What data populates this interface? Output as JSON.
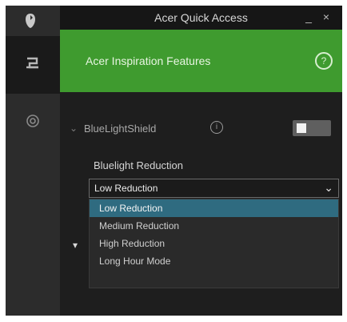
{
  "window": {
    "title": "Acer Quick Access",
    "minimize_glyph": "_",
    "close_glyph": "×"
  },
  "rail": {
    "logo_icon": "acer-logo-icon",
    "tabs": [
      {
        "icon": "monitor-icon",
        "active": true
      },
      {
        "icon": "settings-icon",
        "active": false
      }
    ]
  },
  "banner": {
    "text": "Acer Inspiration Features",
    "help_glyph": "?"
  },
  "bluelight": {
    "section_label": "BlueLightShield",
    "info_glyph": "i",
    "toggle_on": true,
    "reduction_label": "Bluelight Reduction",
    "selected_value": "Low Reduction",
    "options": [
      "Low Reduction",
      "Medium Reduction",
      "High Reduction",
      "Long Hour Mode"
    ],
    "highlighted_index": 0
  },
  "colors": {
    "accent_green": "#3f9b2f",
    "selection_blue": "#2f6b80",
    "background": "#1e1e1e"
  }
}
